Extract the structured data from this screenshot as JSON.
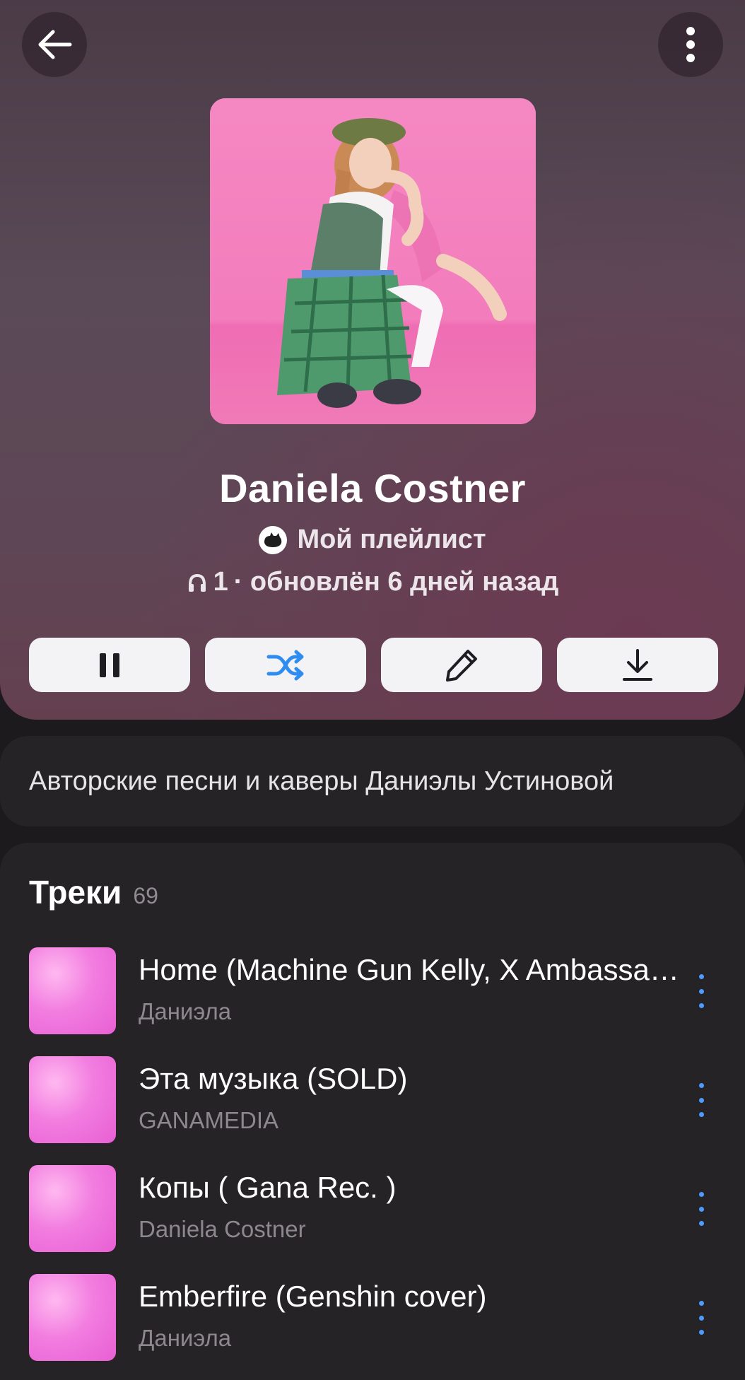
{
  "header": {
    "title": "Daniela Costner",
    "owner": "Мой плейлист",
    "listeners": "1",
    "updated": "· обновлён 6 дней назад"
  },
  "description": "Авторские песни и каверы Даниэлы Устиновой",
  "tracks_section": {
    "title": "Треки",
    "count": "69",
    "items": [
      {
        "title": "Home (Machine Gun Kelly, X Ambassadors, Bebe Rexha cover)",
        "artist": "Даниэла"
      },
      {
        "title": "Эта музыка (SOLD)",
        "artist": "GANAMEDIA"
      },
      {
        "title": "Копы ( Gana Rec. )",
        "artist": "Daniela Costner"
      },
      {
        "title": "Emberfire (Genshin cover)",
        "artist": "Даниэла"
      }
    ]
  },
  "icons": {
    "back": "arrow-left-icon",
    "more": "more-vertical-icon",
    "pause": "pause-icon",
    "shuffle": "shuffle-icon",
    "edit": "pencil-icon",
    "download": "download-icon",
    "headphones": "headphones-icon"
  },
  "colors": {
    "accent": "#4c9bff",
    "background": "#1c1a1d",
    "card": "#252326",
    "button": "#f3f3f6"
  }
}
